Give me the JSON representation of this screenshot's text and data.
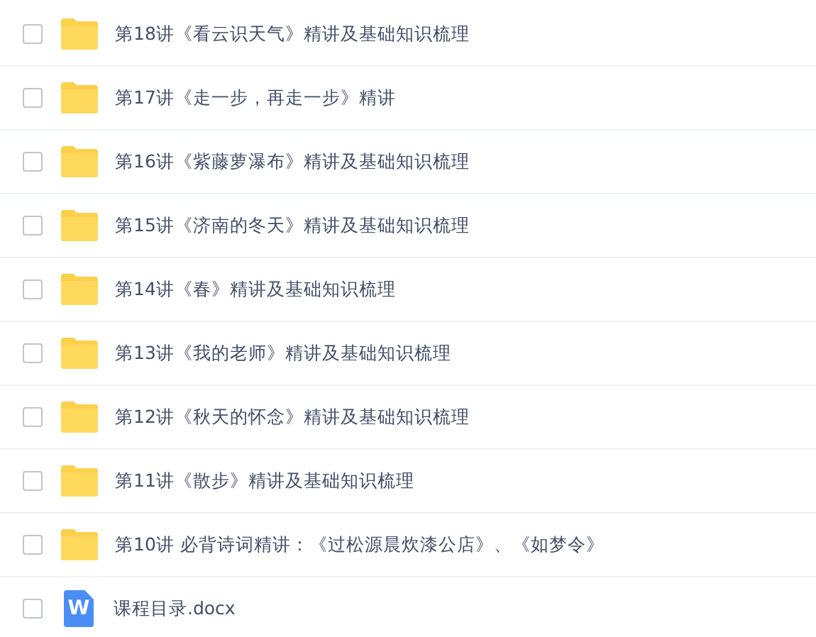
{
  "files": [
    {
      "kind": "folder",
      "name": "第18讲《看云识天气》精讲及基础知识梳理",
      "checked": false
    },
    {
      "kind": "folder",
      "name": "第17讲《走一步，再走一步》精讲",
      "checked": false
    },
    {
      "kind": "folder",
      "name": "第16讲《紫藤萝瀑布》精讲及基础知识梳理",
      "checked": false
    },
    {
      "kind": "folder",
      "name": "第15讲《济南的冬天》精讲及基础知识梳理",
      "checked": false
    },
    {
      "kind": "folder",
      "name": "第14讲《春》精讲及基础知识梳理",
      "checked": false
    },
    {
      "kind": "folder",
      "name": "第13讲《我的老师》精讲及基础知识梳理",
      "checked": false
    },
    {
      "kind": "folder",
      "name": "第12讲《秋天的怀念》精讲及基础知识梳理",
      "checked": false
    },
    {
      "kind": "folder",
      "name": "第11讲《散步》精讲及基础知识梳理",
      "checked": false
    },
    {
      "kind": "folder",
      "name": "第10讲 必背诗词精讲：《过松源晨炊漆公店》、《如梦令》",
      "checked": false
    },
    {
      "kind": "word",
      "icon_letter": "W",
      "name": "课程目录.docx",
      "checked": false
    }
  ]
}
